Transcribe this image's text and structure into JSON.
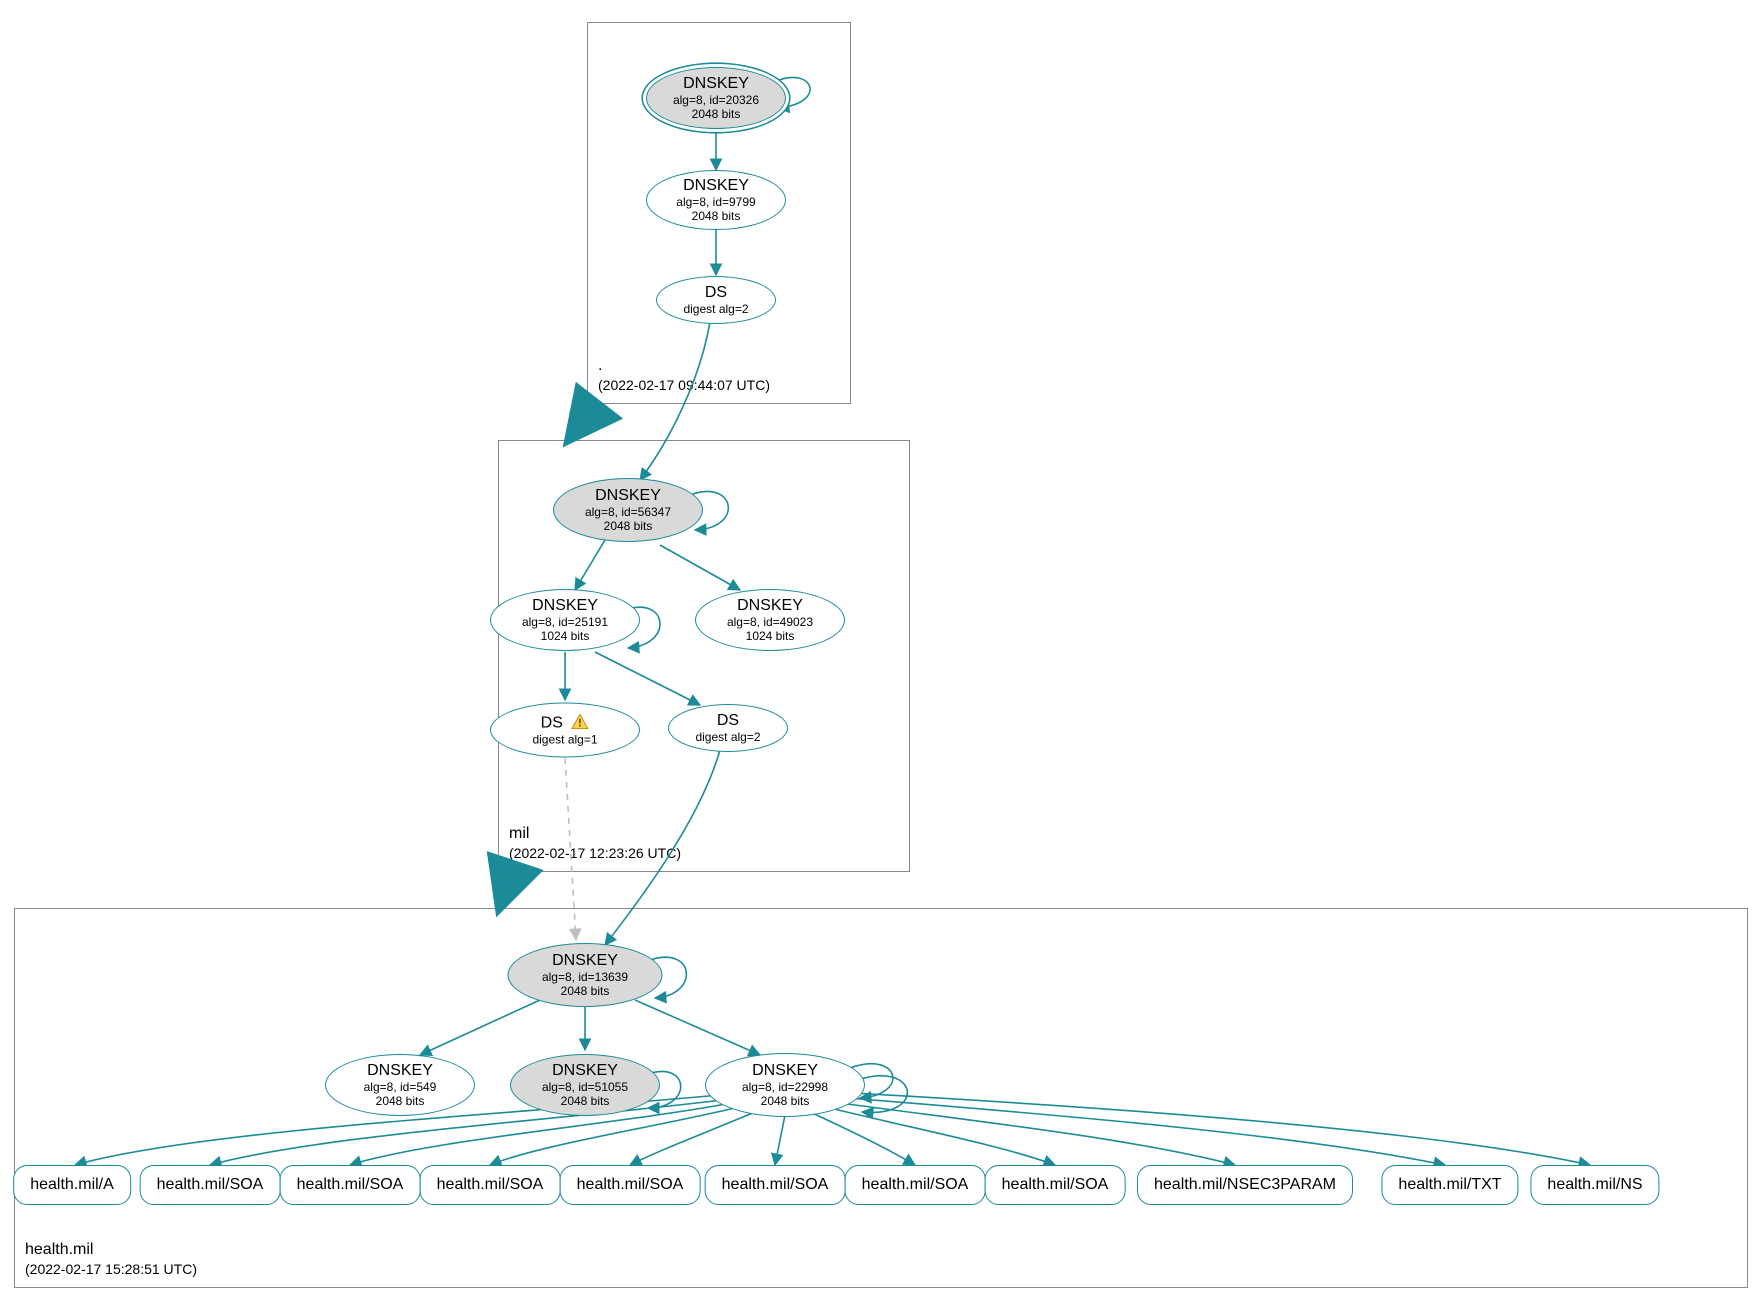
{
  "color_edge": "#1b8b97",
  "zones": {
    "root": {
      "name": ".",
      "timestamp": "(2022-02-17 09:44:07 UTC)"
    },
    "mil": {
      "name": "mil",
      "timestamp": "(2022-02-17 12:23:26 UTC)"
    },
    "health": {
      "name": "health.mil",
      "timestamp": "(2022-02-17 15:28:51 UTC)"
    }
  },
  "nodes": {
    "root_ksk": {
      "title": "DNSKEY",
      "line2": "alg=8, id=20326",
      "line3": "2048 bits"
    },
    "root_zsk": {
      "title": "DNSKEY",
      "line2": "alg=8, id=9799",
      "line3": "2048 bits"
    },
    "root_ds": {
      "title": "DS",
      "line2": "digest alg=2"
    },
    "mil_ksk": {
      "title": "DNSKEY",
      "line2": "alg=8, id=56347",
      "line3": "2048 bits"
    },
    "mil_zsk1": {
      "title": "DNSKEY",
      "line2": "alg=8, id=25191",
      "line3": "1024 bits"
    },
    "mil_zsk2": {
      "title": "DNSKEY",
      "line2": "alg=8, id=49023",
      "line3": "1024 bits"
    },
    "mil_ds1": {
      "title": "DS",
      "line2": "digest alg=1"
    },
    "mil_ds2": {
      "title": "DS",
      "line2": "digest alg=2"
    },
    "h_ksk": {
      "title": "DNSKEY",
      "line2": "alg=8, id=13639",
      "line3": "2048 bits"
    },
    "h_zsk1": {
      "title": "DNSKEY",
      "line2": "alg=8, id=549",
      "line3": "2048 bits"
    },
    "h_zsk2": {
      "title": "DNSKEY",
      "line2": "alg=8, id=51055",
      "line3": "2048 bits"
    },
    "h_zsk3": {
      "title": "DNSKEY",
      "line2": "alg=8, id=22998",
      "line3": "2048 bits"
    }
  },
  "rrsets": {
    "r0": "health.mil/A",
    "r1": "health.mil/SOA",
    "r2": "health.mil/SOA",
    "r3": "health.mil/SOA",
    "r4": "health.mil/SOA",
    "r5": "health.mil/SOA",
    "r6": "health.mil/SOA",
    "r7": "health.mil/SOA",
    "r8": "health.mil/NSEC3PARAM",
    "r9": "health.mil/TXT",
    "r10": "health.mil/NS"
  },
  "icons": {
    "warning": "warning-triangle"
  }
}
